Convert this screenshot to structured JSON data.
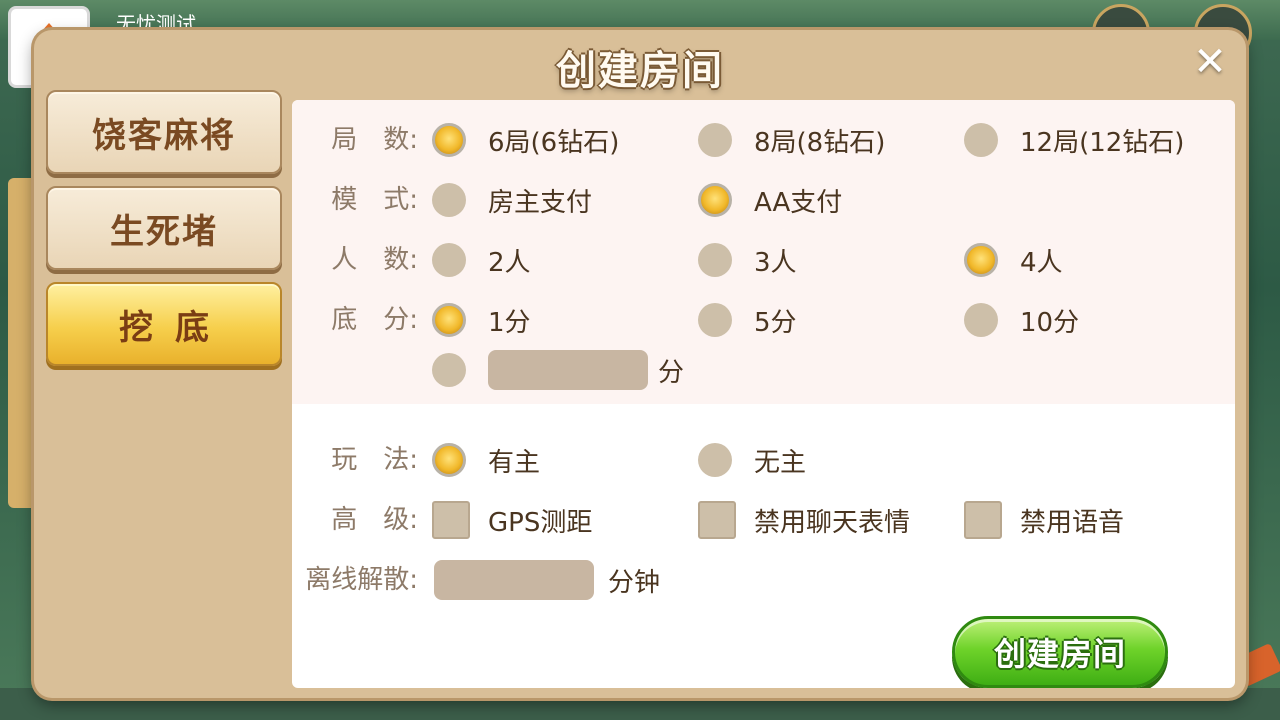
{
  "background": {
    "username": "无忧测试"
  },
  "dialog": {
    "title": "创建房间",
    "close_label": "✕"
  },
  "sidebar": {
    "items": [
      {
        "label": "饶客麻将",
        "active": false
      },
      {
        "label": "生死堵",
        "active": false
      },
      {
        "label": "挖底",
        "active": true
      }
    ]
  },
  "form": {
    "rounds": {
      "label": "局　数:",
      "options": [
        {
          "text": "6局(6钻石)",
          "selected": true
        },
        {
          "text": "8局(8钻石)",
          "selected": false
        },
        {
          "text": "12局(12钻石)",
          "selected": false
        }
      ]
    },
    "mode": {
      "label": "模　式:",
      "options": [
        {
          "text": "房主支付",
          "selected": false
        },
        {
          "text": "AA支付",
          "selected": true
        }
      ]
    },
    "players": {
      "label": "人　数:",
      "options": [
        {
          "text": "2人",
          "selected": false
        },
        {
          "text": "3人",
          "selected": false
        },
        {
          "text": "4人",
          "selected": true
        }
      ]
    },
    "base_score": {
      "label": "底　分:",
      "options": [
        {
          "text": "1分",
          "selected": true
        },
        {
          "text": "5分",
          "selected": false
        },
        {
          "text": "10分",
          "selected": false
        }
      ],
      "custom_value": "",
      "custom_unit": "分"
    },
    "play_style": {
      "label": "玩　法:",
      "options": [
        {
          "text": "有主",
          "selected": true
        },
        {
          "text": "无主",
          "selected": false
        }
      ]
    },
    "advanced": {
      "label": "高　级:",
      "options": [
        {
          "text": "GPS测距",
          "checked": false
        },
        {
          "text": "禁用聊天表情",
          "checked": false
        },
        {
          "text": "禁用语音",
          "checked": false
        }
      ]
    },
    "offline_dissolve": {
      "label": "离线解散:",
      "value": "",
      "unit": "分钟"
    }
  },
  "create_button_label": "创建房间",
  "colors": {
    "dialog_bg": "#d9bf98",
    "active_tab": "#f6cf4c",
    "create_button": "#6fd32a",
    "radio_on": "#f1b82a",
    "radio_off": "#cdbfa9"
  }
}
